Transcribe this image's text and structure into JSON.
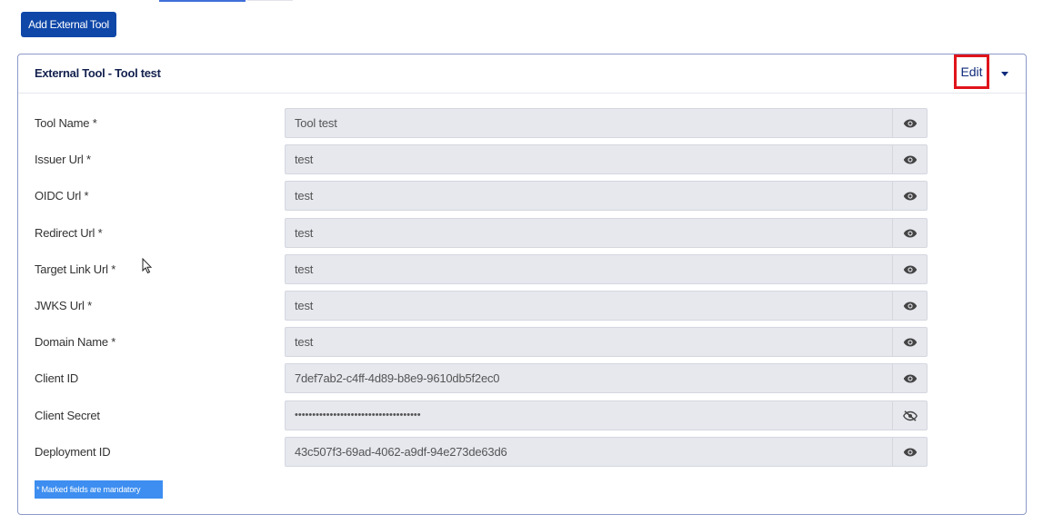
{
  "toolbar": {
    "add_label": "Add External Tool"
  },
  "panel": {
    "title": "External Tool - Tool test",
    "edit_label": "Edit"
  },
  "fields": [
    {
      "label": "Tool Name *",
      "value": "Tool test",
      "icon": "eye-icon"
    },
    {
      "label": "Issuer Url *",
      "value": "test",
      "icon": "eye-icon"
    },
    {
      "label": "OIDC Url *",
      "value": "test",
      "icon": "eye-icon"
    },
    {
      "label": "Redirect Url *",
      "value": "test",
      "icon": "eye-icon"
    },
    {
      "label": "Target Link Url *",
      "value": "test",
      "icon": "eye-icon"
    },
    {
      "label": "JWKS Url *",
      "value": "test",
      "icon": "eye-icon"
    },
    {
      "label": "Domain Name *",
      "value": "test",
      "icon": "eye-icon"
    },
    {
      "label": "Client ID",
      "value": "7def7ab2-c4ff-4d89-b8e9-9610db5f2ec0",
      "icon": "eye-icon"
    },
    {
      "label": "Client Secret",
      "value": "••••••••••••••••••••••••••••••••••••",
      "icon": "eye-slash-icon"
    },
    {
      "label": "Deployment ID",
      "value": "43c507f3-69ad-4062-a9df-94e273de63d6",
      "icon": "eye-icon"
    }
  ],
  "footer": {
    "mandatory_note": "* Marked fields are mandatory"
  },
  "colors": {
    "primary": "#0f47a8",
    "edit_highlight": "#e0141b",
    "note_bg": "#3d8ef0"
  }
}
